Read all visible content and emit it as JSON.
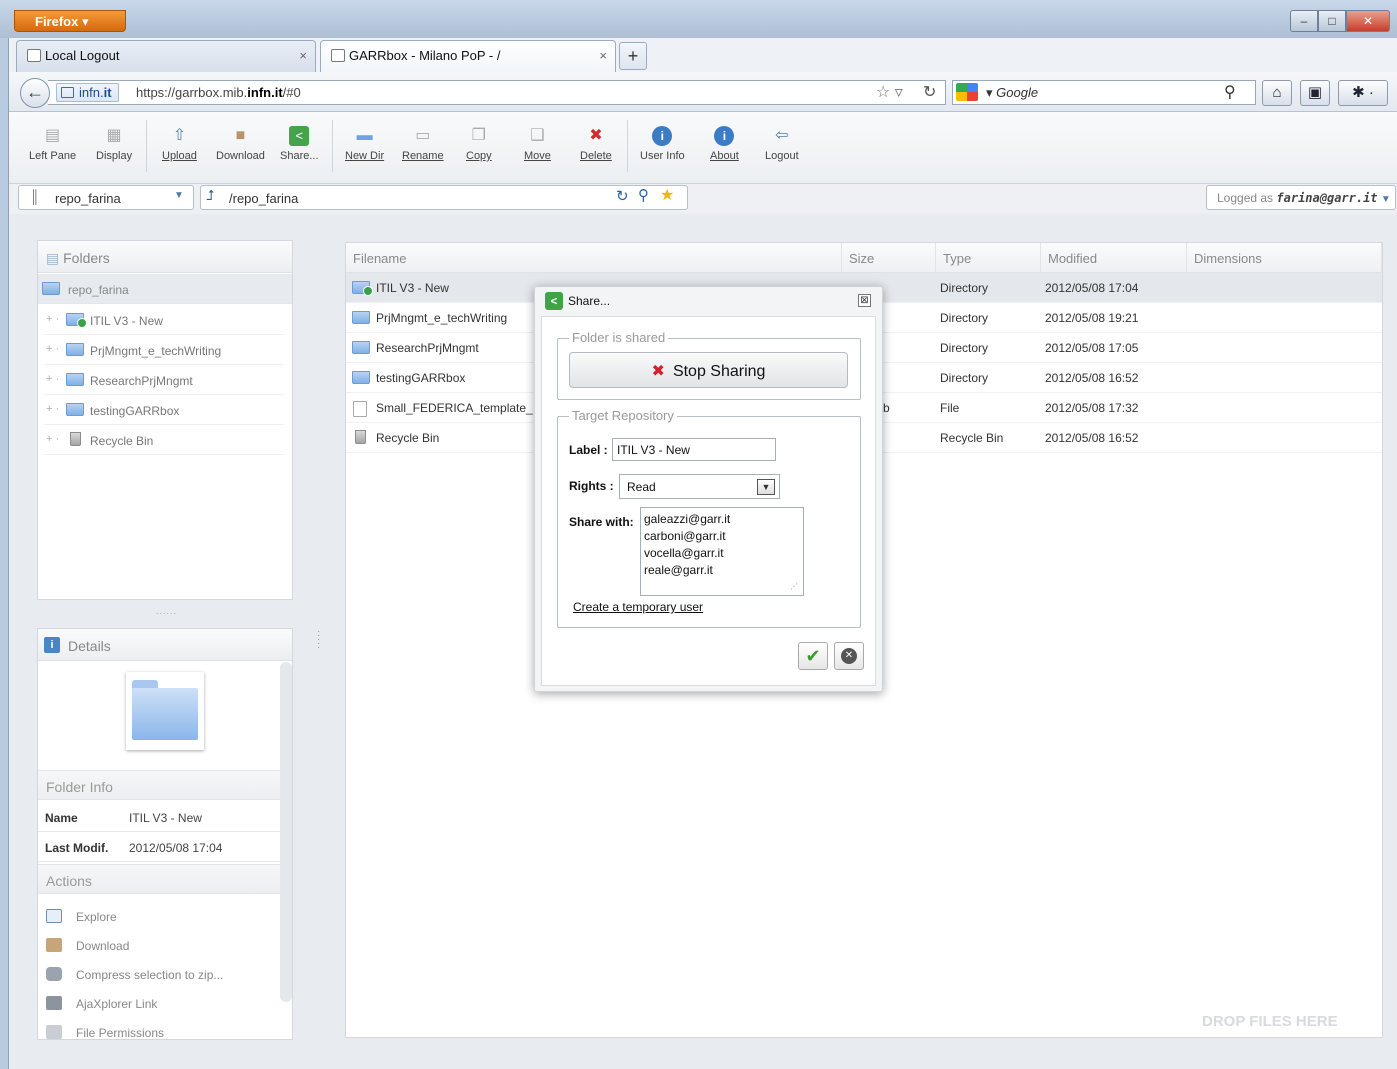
{
  "browser": {
    "menu_button": "Firefox",
    "tabs": [
      {
        "label": "Local Logout",
        "close": "×"
      },
      {
        "label": "GARRbox - Milano PoP - /",
        "close": "×"
      }
    ],
    "new_tab": "+",
    "identity": {
      "prefix": "infn.",
      "domain": "it"
    },
    "url": {
      "prefix": "https://garrbox.mib.",
      "host": "infn.it",
      "suffix": "/#0"
    },
    "search_placeholder": "Google",
    "window_controls": {
      "min": "–",
      "max": "□",
      "close": "✕"
    }
  },
  "toolbar": {
    "buttons": [
      {
        "label": "Left Pane",
        "icon": "left-pane-icon"
      },
      {
        "label": "Display",
        "icon": "display-icon"
      },
      {
        "label": "Upload",
        "icon": "upload-icon"
      },
      {
        "label": "Download",
        "icon": "download-icon"
      },
      {
        "label": "Share...",
        "icon": "share-icon"
      },
      {
        "label": "New Dir",
        "icon": "new-dir-icon"
      },
      {
        "label": "Rename",
        "icon": "rename-icon"
      },
      {
        "label": "Copy",
        "icon": "copy-icon"
      },
      {
        "label": "Move",
        "icon": "move-icon"
      },
      {
        "label": "Delete",
        "icon": "delete-icon"
      },
      {
        "label": "User Info",
        "icon": "info-icon"
      },
      {
        "label": "About",
        "icon": "info-icon"
      },
      {
        "label": "Logout",
        "icon": "logout-icon"
      }
    ]
  },
  "location": {
    "repository": "repo_farina",
    "path": "/repo_farina",
    "logged_prefix": "Logged as ",
    "logged_user": "farina@garr.it"
  },
  "folders": {
    "title": "Folders",
    "root": "repo_farina",
    "items": [
      "ITIL V3 - New",
      "PrjMngmt_e_techWriting",
      "ResearchPrjMngmt",
      "testingGARRbox",
      "Recycle Bin"
    ]
  },
  "details": {
    "title": "Details",
    "folder_info_title": "Folder Info",
    "name_label": "Name",
    "name_value": "ITIL V3 - New",
    "modif_label": "Last Modif.",
    "modif_value": "2012/05/08 17:04",
    "actions_title": "Actions",
    "actions": [
      "Explore",
      "Download",
      "Compress selection to zip...",
      "AjaXplorer Link",
      "File Permissions"
    ]
  },
  "file_list": {
    "columns": [
      "Filename",
      "Size",
      "Type",
      "Modified",
      "Dimensions"
    ],
    "rows": [
      {
        "name": "ITIL V3 - New",
        "size": "",
        "type": "Directory",
        "modified": "2012/05/08 17:04"
      },
      {
        "name": "PrjMngmt_e_techWriting",
        "size": "",
        "type": "Directory",
        "modified": "2012/05/08 19:21"
      },
      {
        "name": "ResearchPrjMngmt",
        "size": "",
        "type": "Directory",
        "modified": "2012/05/08 17:05"
      },
      {
        "name": "testingGARRbox",
        "size": "",
        "type": "Directory",
        "modified": "2012/05/08 16:52"
      },
      {
        "name": "Small_FEDERICA_template_",
        "size": "b",
        "type": "File",
        "modified": "2012/05/08 17:32"
      },
      {
        "name": "Recycle Bin",
        "size": "",
        "type": "Recycle Bin",
        "modified": "2012/05/08 16:52"
      }
    ],
    "drop_hint": "DROP FILES HERE"
  },
  "dialog": {
    "title": "Share...",
    "close": "⊠",
    "shared_legend": "Folder is shared",
    "stop_sharing": "Stop Sharing",
    "target_legend": "Target Repository",
    "label_caption": "Label :",
    "label_value": "ITIL V3 - New",
    "rights_caption": "Rights :",
    "rights_value": "Read",
    "share_caption": "Share with:",
    "share_with": "galeazzi@garr.it\ncarboni@garr.it\nvocella@garr.it\nreale@garr.it",
    "temp_user_link": "Create a temporary user"
  }
}
